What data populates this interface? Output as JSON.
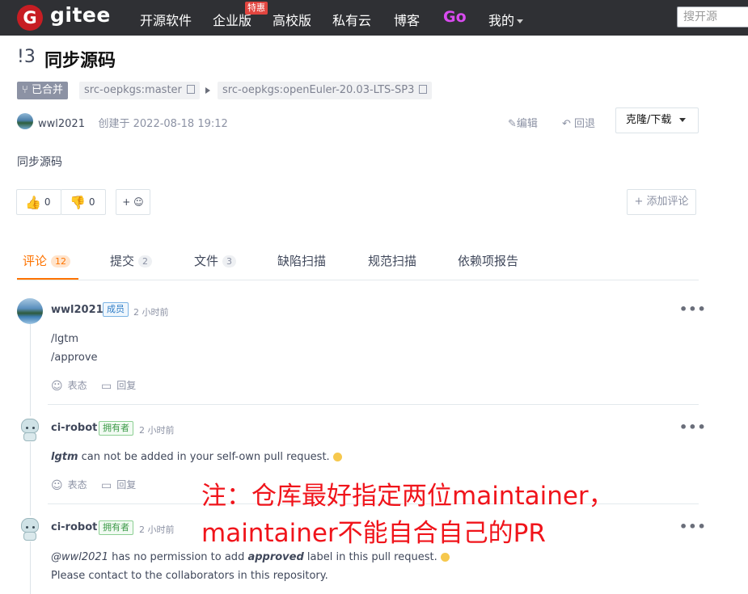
{
  "topbar": {
    "logo_letter": "G",
    "logo_text": "gitee",
    "nav": [
      "开源软件",
      "企业版",
      "高校版",
      "私有云",
      "博客",
      "Go",
      "我的"
    ],
    "hot_badge": "特惠",
    "search_placeholder": "搜开源",
    "colors": {
      "bar": "#2f3034",
      "go": "#d94bf0",
      "badge": "#e2453f"
    }
  },
  "pr": {
    "number": "!3",
    "title": "同步源码",
    "state": "已合并",
    "source_branch": "src-oepkgs:master",
    "target_branch": "src-oepkgs:openEuler-20.03-LTS-SP3",
    "author": "wwl2021",
    "created": "创建于 2022-08-18 19:12",
    "edit_label": "编辑",
    "revert_label": "回退",
    "clone_label": "克隆/下载",
    "body": "同步源码",
    "likes": "0",
    "dislikes": "0",
    "add_reaction": "+ ☺",
    "add_comment": "+ 添加评论"
  },
  "tabs": [
    {
      "label": "评论",
      "count": "12"
    },
    {
      "label": "提交",
      "count": "2"
    },
    {
      "label": "文件",
      "count": "3"
    },
    {
      "label": "缺陷扫描",
      "count": ""
    },
    {
      "label": "规范扫描",
      "count": ""
    },
    {
      "label": "依赖项报告",
      "count": ""
    }
  ],
  "comments": [
    {
      "author": "wwl2021",
      "role": "成员",
      "time": "2 小时前",
      "lines": [
        "/lgtm",
        "/approve"
      ],
      "actions": [
        "表态",
        "回复"
      ]
    },
    {
      "author": "ci-robot",
      "role": "拥有者",
      "time": "2 小时前",
      "line1_bold": "lgtm",
      "line1_rest": " can not be added in your self-own pull request.",
      "actions": [
        "表态",
        "回复"
      ]
    },
    {
      "author": "ci-robot",
      "role": "拥有者",
      "time": "2 小时前",
      "line1_mention": "@wwl2021",
      "line1_mid": " has no permission to add ",
      "line1_bold": "approved",
      "line1_rest": " label in this pull request.",
      "line2": "Please contact to the collaborators in this repository."
    }
  ],
  "more_label": "•••",
  "annotation": {
    "line1": "注：仓库最好指定两位maintainer，",
    "line2": "maintainer不能自合自己的PR",
    "color": "#f0141b"
  },
  "accent": "#fe7300"
}
